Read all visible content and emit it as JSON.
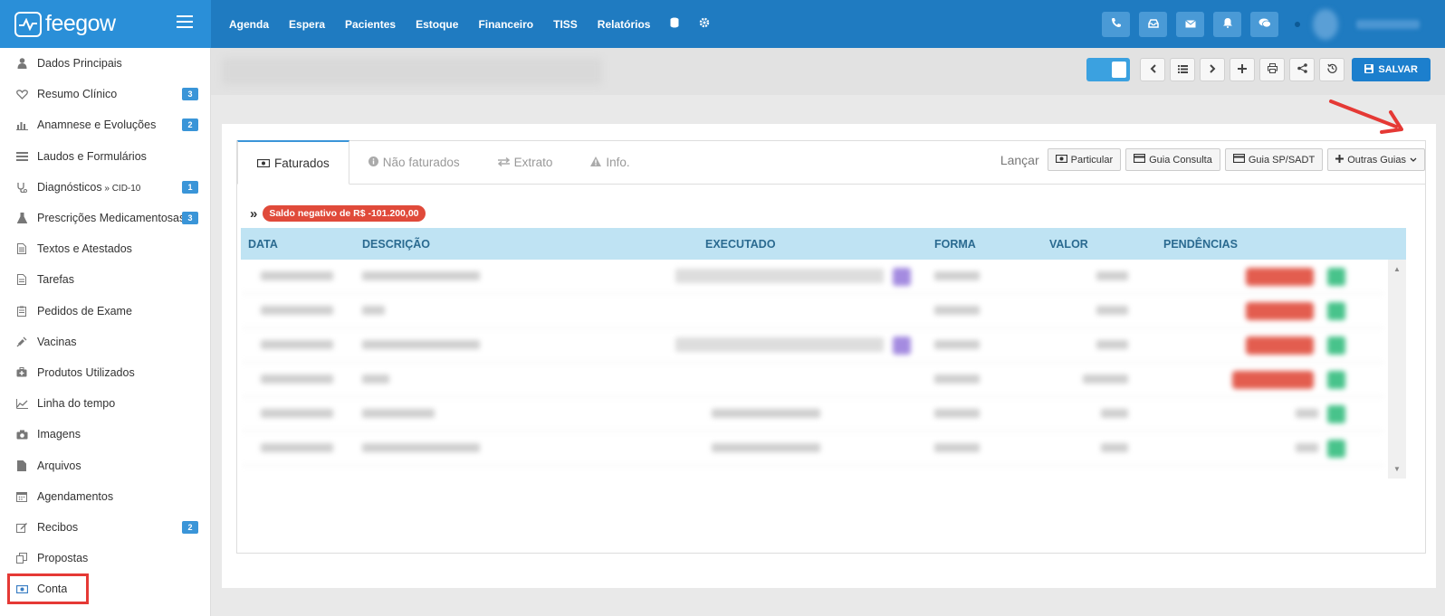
{
  "brand": {
    "name": "feegow"
  },
  "nav": {
    "items": [
      "Agenda",
      "Espera",
      "Pacientes",
      "Estoque",
      "Financeiro",
      "TISS",
      "Relatórios"
    ]
  },
  "sidebar": {
    "items": [
      {
        "label": "Dados Principais",
        "icon": "user-icon",
        "badge": ""
      },
      {
        "label": "Resumo Clínico",
        "icon": "heart-icon",
        "badge": "3"
      },
      {
        "label": "Anamnese e Evoluções",
        "icon": "bar-chart-icon",
        "badge": "2"
      },
      {
        "label": "Laudos e Formulários",
        "icon": "list-icon",
        "badge": ""
      },
      {
        "label": "Diagnósticos",
        "sub": " » CID-10",
        "icon": "stethoscope-icon",
        "badge": "1"
      },
      {
        "label": "Prescrições Medicamentosas",
        "icon": "flask-icon",
        "badge": "3"
      },
      {
        "label": "Textos e Atestados",
        "icon": "document-icon",
        "badge": ""
      },
      {
        "label": "Tarefas",
        "icon": "file-icon",
        "badge": ""
      },
      {
        "label": "Pedidos de Exame",
        "icon": "clipboard-icon",
        "badge": ""
      },
      {
        "label": "Vacinas",
        "icon": "syringe-icon",
        "badge": ""
      },
      {
        "label": "Produtos Utilizados",
        "icon": "medkit-icon",
        "badge": ""
      },
      {
        "label": "Linha do tempo",
        "icon": "line-chart-icon",
        "badge": ""
      },
      {
        "label": "Imagens",
        "icon": "camera-icon",
        "badge": ""
      },
      {
        "label": "Arquivos",
        "icon": "file-solid-icon",
        "badge": ""
      },
      {
        "label": "Agendamentos",
        "icon": "calendar-icon",
        "badge": ""
      },
      {
        "label": "Recibos",
        "icon": "edit-icon",
        "badge": "2"
      },
      {
        "label": "Propostas",
        "icon": "copy-icon",
        "badge": ""
      },
      {
        "label": "Conta",
        "icon": "money-icon",
        "badge": ""
      }
    ]
  },
  "toolbar": {
    "save_label": "SALVAR"
  },
  "tabs": [
    {
      "label": "Faturados",
      "icon": "money-icon"
    },
    {
      "label": "Não faturados",
      "icon": "info-circle-icon"
    },
    {
      "label": "Extrato",
      "icon": "exchange-icon"
    },
    {
      "label": "Info.",
      "icon": "warning-icon"
    }
  ],
  "launch": {
    "label": "Lançar",
    "buttons": [
      "Particular",
      "Guia Consulta",
      "Guia SP/SADT",
      "Outras Guias"
    ]
  },
  "saldo": {
    "prefix": "»",
    "text": "Saldo negativo de R$ -101.200,00"
  },
  "table": {
    "columns": [
      "DATA",
      "DESCRIÇÃO",
      "EXECUTADO",
      "FORMA",
      "VALOR",
      "PENDÊNCIAS"
    ]
  },
  "colors": {
    "accent": "#1f7bc1",
    "badge": "#3a95d8",
    "negative": "#e04a3a",
    "header_row": "#bfe3f3"
  }
}
